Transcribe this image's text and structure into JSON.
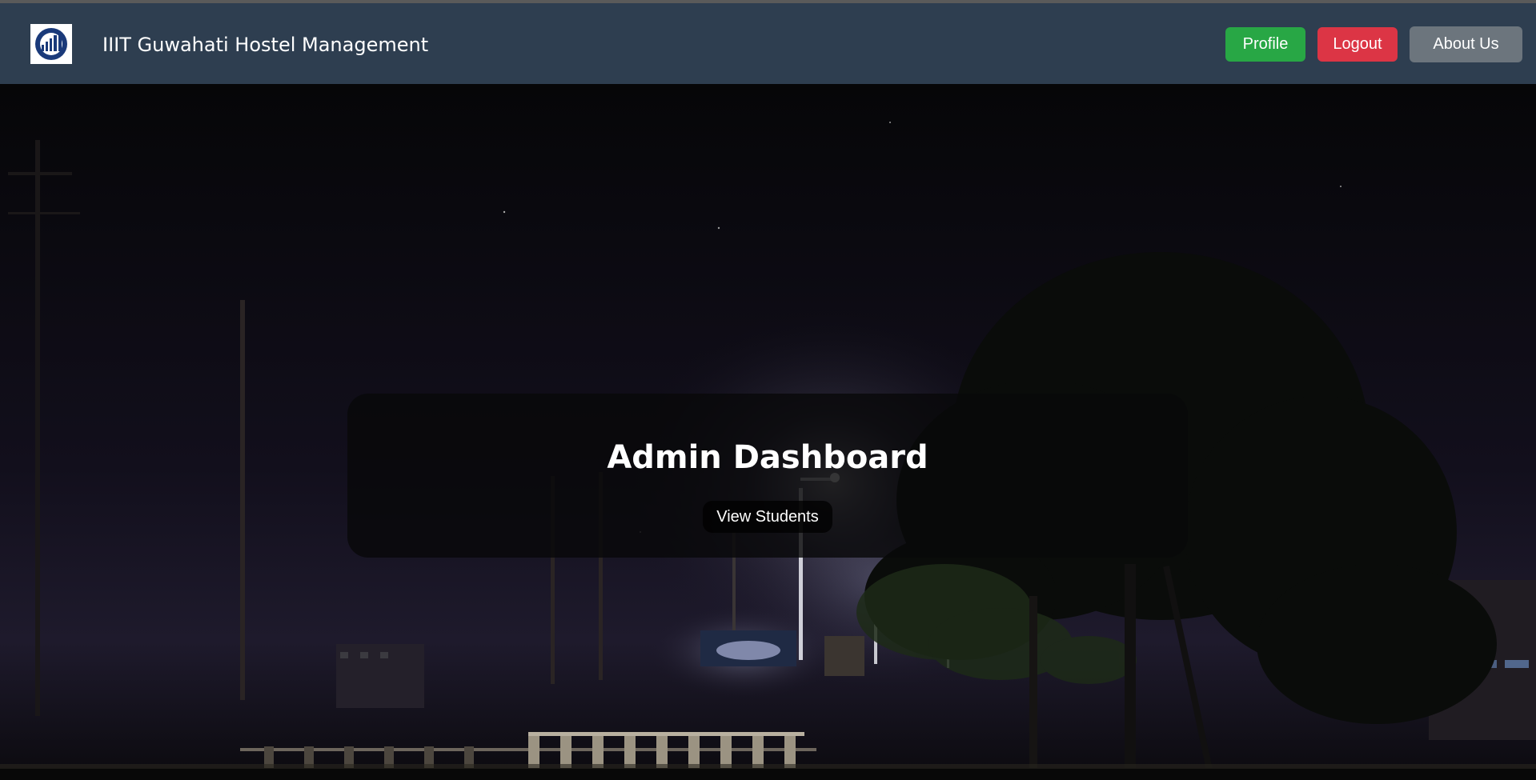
{
  "header": {
    "logo_icon": "institute-logo-icon",
    "brand_title": "IIIT Guwahati Hostel Management",
    "buttons": {
      "profile": "Profile",
      "logout": "Logout",
      "about": "About Us"
    }
  },
  "colors": {
    "navbar": "#2e3e50",
    "profile": "#28a745",
    "logout": "#dc3545",
    "about": "#6c757d"
  },
  "main": {
    "title": "Admin Dashboard",
    "view_students": "View Students"
  }
}
